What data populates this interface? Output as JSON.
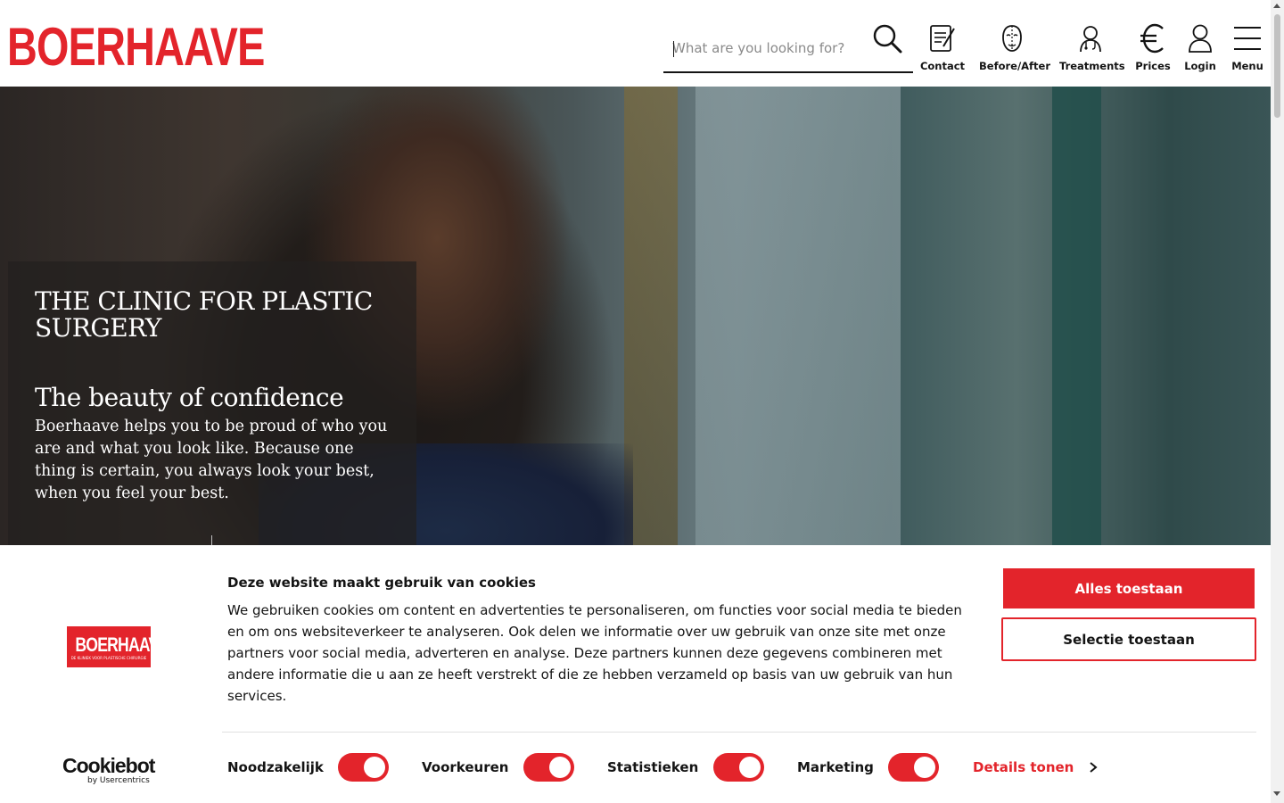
{
  "header": {
    "logo_text": "BOERHAAVE",
    "search_placeholder": "What are you looking for?",
    "nav": [
      {
        "label": "Contact",
        "icon": "contact-form-icon"
      },
      {
        "label": "Before/After",
        "icon": "face-icon"
      },
      {
        "label": "Treatments",
        "icon": "doctor-icon"
      },
      {
        "label": "Prices",
        "icon": "euro-icon"
      },
      {
        "label": "Login",
        "icon": "user-icon"
      },
      {
        "label": "Menu",
        "icon": "hamburger-icon"
      }
    ]
  },
  "hero": {
    "title": "THE CLINIC FOR PLASTIC SURGERY",
    "subtitle": "The beauty of confidence",
    "text": "Boerhaave helps you to be proud of who you are and what you look like. Because one thing is certain, you always look your best, when you feel your best."
  },
  "cookie_banner": {
    "logo_text": "BOERHAAVE",
    "logo_subtext": "DE KLINIEK VOOR PLASTISCHE CHIRURGIE",
    "title": "Deze website maakt gebruik van cookies",
    "text": "We gebruiken cookies om content en advertenties te personaliseren, om functies voor social media te bieden en om ons websiteverkeer te analyseren. Ook delen we informatie over uw gebruik van onze site met onze partners voor social media, adverteren en analyse. Deze partners kunnen deze gegevens combineren met andere informatie die u aan ze heeft verstrekt of die ze hebben verzameld op basis van uw gebruik van hun services.",
    "allow_all": "Alles toestaan",
    "allow_selection": "Selectie toestaan",
    "toggles": [
      {
        "label": "Noodzakelijk",
        "on": true
      },
      {
        "label": "Voorkeuren",
        "on": true
      },
      {
        "label": "Statistieken",
        "on": true
      },
      {
        "label": "Marketing",
        "on": true
      }
    ],
    "details": "Details tonen",
    "cookiebot_brand": "Cookiebot",
    "cookiebot_sub": "by Usercentrics"
  },
  "colors": {
    "accent": "#e3242b",
    "text": "#141414"
  }
}
